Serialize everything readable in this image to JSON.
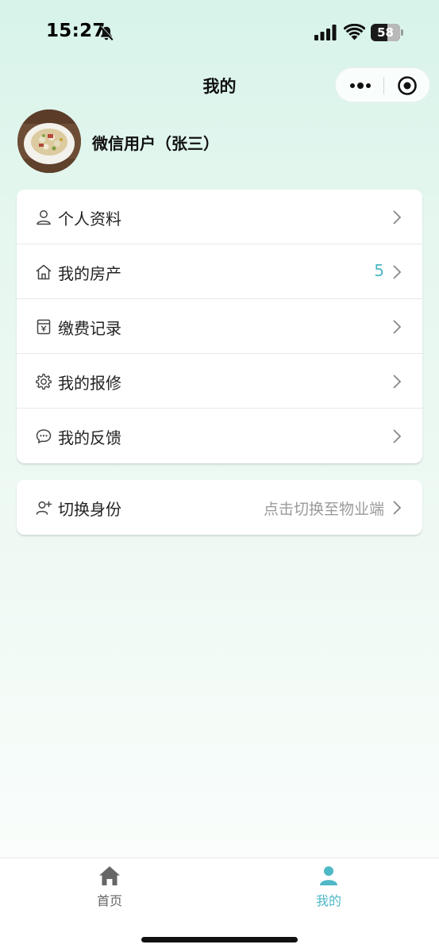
{
  "status_bar": {
    "time": "15:27",
    "battery_level": "58"
  },
  "nav": {
    "title": "我的"
  },
  "profile": {
    "username": "微信用户（张三）"
  },
  "menu": [
    {
      "label": "个人资料",
      "icon": "user-icon"
    },
    {
      "label": "我的房产",
      "icon": "house-icon",
      "badge": "5"
    },
    {
      "label": "缴费记录",
      "icon": "receipt-icon"
    },
    {
      "label": "我的报修",
      "icon": "gear-icon"
    },
    {
      "label": "我的反馈",
      "icon": "chat-bubble-icon"
    }
  ],
  "switch_identity": {
    "label": "切换身份",
    "icon": "user-switch-icon",
    "hint": "点击切换至物业端"
  },
  "tabbar": {
    "home_label": "首页",
    "me_label": "我的"
  },
  "colors": {
    "accent": "#4fb8c6",
    "text": "#222222",
    "hint": "#9a9a9a"
  }
}
